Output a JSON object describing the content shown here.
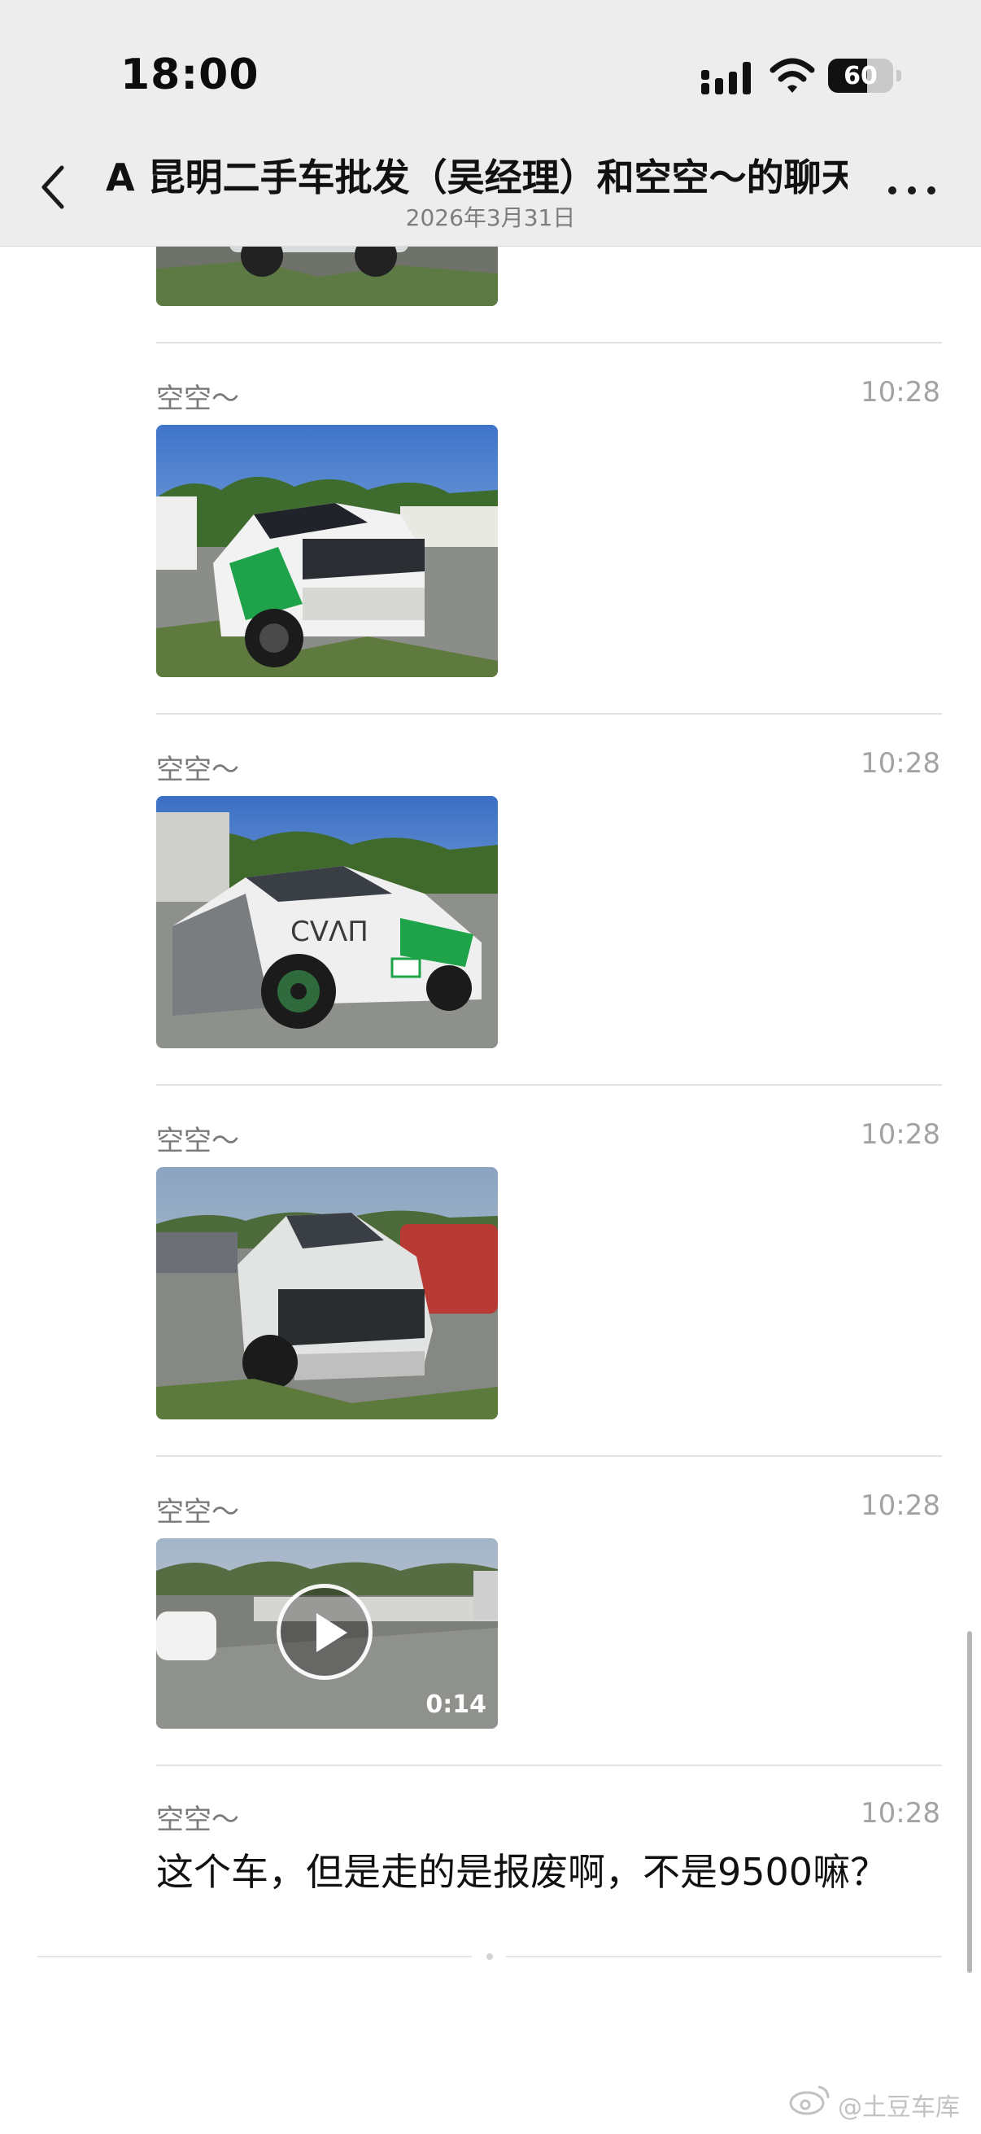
{
  "status_bar": {
    "time": "18:00",
    "battery_level": "60"
  },
  "header": {
    "title": "A 昆明二手车批发（吴经理）和空空～的聊天记录",
    "subtitle": "2026年3月31日"
  },
  "messages": [
    {
      "sender": "空空～",
      "time": "10:28",
      "type": "image"
    },
    {
      "sender": "空空～",
      "time": "10:28",
      "type": "image"
    },
    {
      "sender": "空空～",
      "time": "10:28",
      "type": "image"
    },
    {
      "sender": "空空～",
      "time": "10:28",
      "type": "video",
      "duration": "0:14"
    },
    {
      "sender": "空空～",
      "time": "10:28",
      "type": "text",
      "text": "这个车，但是走的是报废啊，不是9500嘛？"
    }
  ],
  "watermark": {
    "text": "@土豆车库"
  },
  "colors": {
    "header_bg": "#ededed",
    "muted": "#a3a3a3",
    "green_wrap": "#1fa34a"
  }
}
